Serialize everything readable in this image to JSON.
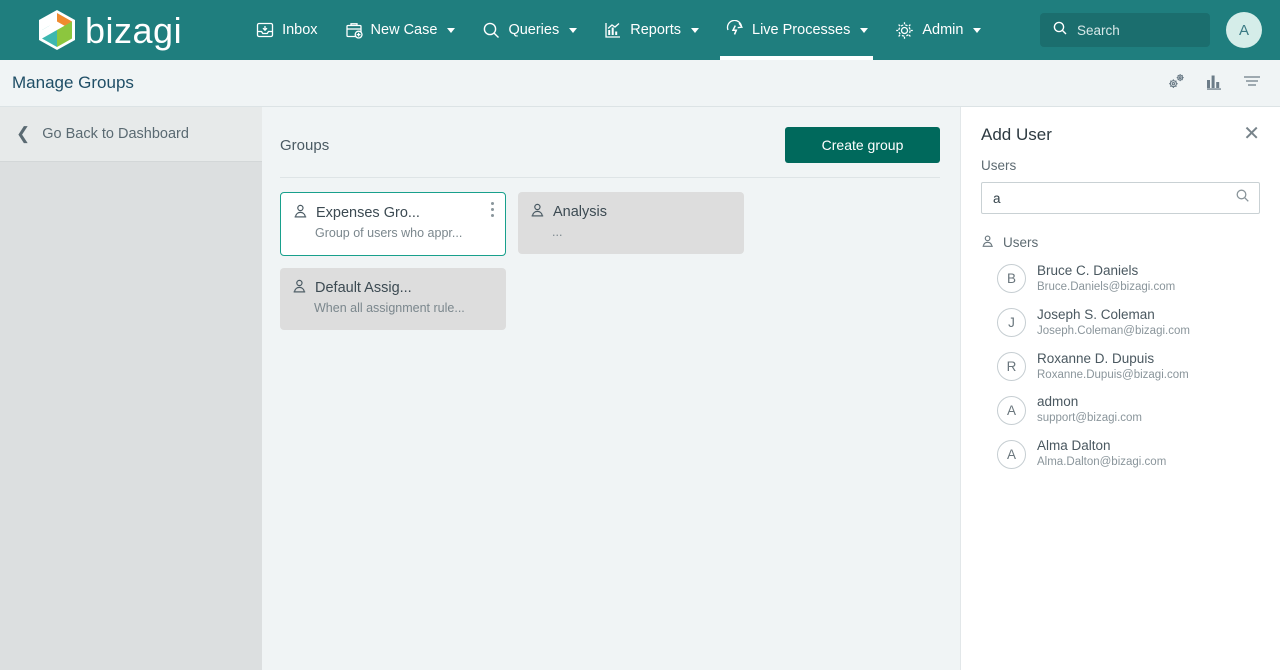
{
  "nav": {
    "brand": "bizagi",
    "items": [
      {
        "label": "Inbox",
        "icon": "inbox-icon",
        "caret": false,
        "active": false
      },
      {
        "label": "New Case",
        "icon": "briefcase-plus-icon",
        "caret": true,
        "active": false
      },
      {
        "label": "Queries",
        "icon": "search-icon",
        "caret": true,
        "active": false
      },
      {
        "label": "Reports",
        "icon": "bar-chart-icon",
        "caret": true,
        "active": false
      },
      {
        "label": "Live Processes",
        "icon": "live-process-icon",
        "caret": true,
        "active": true
      },
      {
        "label": "Admin",
        "icon": "gear-icon",
        "caret": true,
        "active": false
      }
    ],
    "search_placeholder": "Search",
    "search_value": "",
    "avatar_initial": "A"
  },
  "header": {
    "title": "Manage Groups",
    "tools": [
      {
        "name": "gears-icon"
      },
      {
        "name": "bar-chart-icon"
      },
      {
        "name": "hamburger-menu-icon"
      }
    ]
  },
  "sidebar": {
    "back_label": "Go Back to Dashboard"
  },
  "main": {
    "groups_label": "Groups",
    "create_button": "Create group",
    "cards": [
      {
        "title": "Expenses Gro...",
        "description": "Group of users who appr...",
        "selected": true,
        "menu": true
      },
      {
        "title": "Analysis",
        "description": "...",
        "selected": false,
        "menu": false
      },
      {
        "title": "Default Assig...",
        "description": "When all assignment rule...",
        "selected": false,
        "menu": false
      }
    ]
  },
  "panel": {
    "title": "Add User",
    "field_label": "Users",
    "search_value": "a",
    "search_placeholder": "",
    "users_section_label": "Users",
    "users": [
      {
        "initial": "B",
        "name": "Bruce C. Daniels",
        "email": "Bruce.Daniels@bizagi.com"
      },
      {
        "initial": "J",
        "name": "Joseph S. Coleman",
        "email": "Joseph.Coleman@bizagi.com"
      },
      {
        "initial": "R",
        "name": "Roxanne D. Dupuis",
        "email": "Roxanne.Dupuis@bizagi.com"
      },
      {
        "initial": "A",
        "name": "admon",
        "email": "support@bizagi.com"
      },
      {
        "initial": "A",
        "name": "Alma Dalton",
        "email": "Alma.Dalton@bizagi.com"
      }
    ]
  },
  "colors": {
    "nav_teal": "#1F7E7E",
    "button_teal": "#00695C",
    "selected_border": "#18A08C",
    "page_bg": "#F0F4F5",
    "sidebar_bg": "#DCDFE0"
  }
}
